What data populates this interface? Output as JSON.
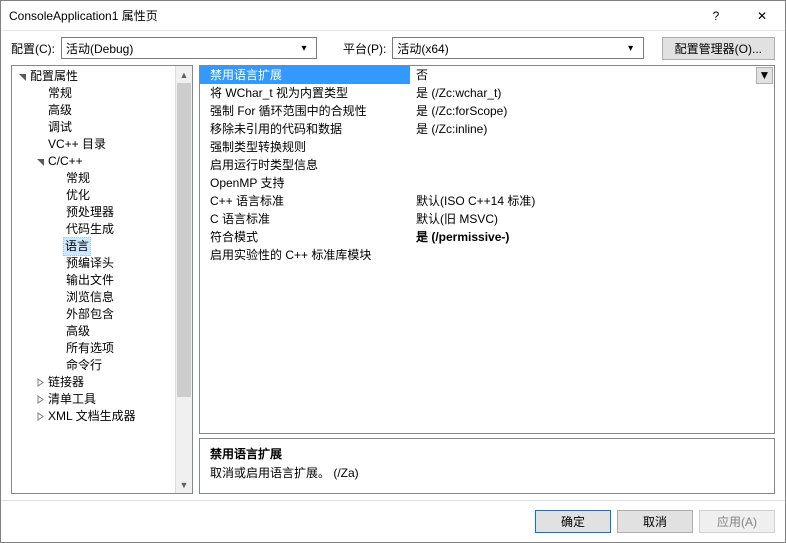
{
  "window": {
    "title": "ConsoleApplication1 属性页"
  },
  "titlebar_icons": {
    "help": "?",
    "close": "✕"
  },
  "config": {
    "config_label": "配置(C):",
    "config_value": "活动(Debug)",
    "platform_label": "平台(P):",
    "platform_value": "活动(x64)",
    "manager_button": "配置管理器(O)..."
  },
  "tree": [
    {
      "label": "配置属性",
      "depth": 0,
      "expander": "down",
      "selected": false
    },
    {
      "label": "常规",
      "depth": 1,
      "expander": "",
      "selected": false
    },
    {
      "label": "高级",
      "depth": 1,
      "expander": "",
      "selected": false
    },
    {
      "label": "调试",
      "depth": 1,
      "expander": "",
      "selected": false
    },
    {
      "label": "VC++ 目录",
      "depth": 1,
      "expander": "",
      "selected": false
    },
    {
      "label": "C/C++",
      "depth": 1,
      "expander": "down",
      "selected": false
    },
    {
      "label": "常规",
      "depth": 2,
      "expander": "",
      "selected": false
    },
    {
      "label": "优化",
      "depth": 2,
      "expander": "",
      "selected": false
    },
    {
      "label": "预处理器",
      "depth": 2,
      "expander": "",
      "selected": false
    },
    {
      "label": "代码生成",
      "depth": 2,
      "expander": "",
      "selected": false
    },
    {
      "label": "语言",
      "depth": 2,
      "expander": "",
      "selected": true
    },
    {
      "label": "预编译头",
      "depth": 2,
      "expander": "",
      "selected": false
    },
    {
      "label": "输出文件",
      "depth": 2,
      "expander": "",
      "selected": false
    },
    {
      "label": "浏览信息",
      "depth": 2,
      "expander": "",
      "selected": false
    },
    {
      "label": "外部包含",
      "depth": 2,
      "expander": "",
      "selected": false
    },
    {
      "label": "高级",
      "depth": 2,
      "expander": "",
      "selected": false
    },
    {
      "label": "所有选项",
      "depth": 2,
      "expander": "",
      "selected": false
    },
    {
      "label": "命令行",
      "depth": 2,
      "expander": "",
      "selected": false
    },
    {
      "label": "链接器",
      "depth": 1,
      "expander": "right",
      "selected": false
    },
    {
      "label": "清单工具",
      "depth": 1,
      "expander": "right",
      "selected": false
    },
    {
      "label": "XML 文档生成器",
      "depth": 1,
      "expander": "right",
      "selected": false
    }
  ],
  "grid": [
    {
      "name": "禁用语言扩展",
      "value": "否",
      "selected": true,
      "bold": false,
      "dropdown": true
    },
    {
      "name": "将 WChar_t 视为内置类型",
      "value": "是 (/Zc:wchar_t)",
      "selected": false,
      "bold": false
    },
    {
      "name": "强制 For 循环范围中的合规性",
      "value": "是 (/Zc:forScope)",
      "selected": false,
      "bold": false
    },
    {
      "name": "移除未引用的代码和数据",
      "value": "是 (/Zc:inline)",
      "selected": false,
      "bold": false
    },
    {
      "name": "强制类型转换规则",
      "value": "",
      "selected": false,
      "bold": false
    },
    {
      "name": "启用运行时类型信息",
      "value": "",
      "selected": false,
      "bold": false
    },
    {
      "name": "OpenMP 支持",
      "value": "",
      "selected": false,
      "bold": false
    },
    {
      "name": "C++ 语言标准",
      "value": "默认(ISO C++14 标准)",
      "selected": false,
      "bold": false
    },
    {
      "name": "C 语言标准",
      "value": "默认(旧 MSVC)",
      "selected": false,
      "bold": false
    },
    {
      "name": "符合模式",
      "value": "是 (/permissive-)",
      "selected": false,
      "bold": true
    },
    {
      "name": "启用实验性的 C++ 标准库模块",
      "value": "",
      "selected": false,
      "bold": false
    }
  ],
  "description": {
    "title": "禁用语言扩展",
    "body": "取消或启用语言扩展。     (/Za)"
  },
  "footer": {
    "ok": "确定",
    "cancel": "取消",
    "apply": "应用(A)"
  }
}
